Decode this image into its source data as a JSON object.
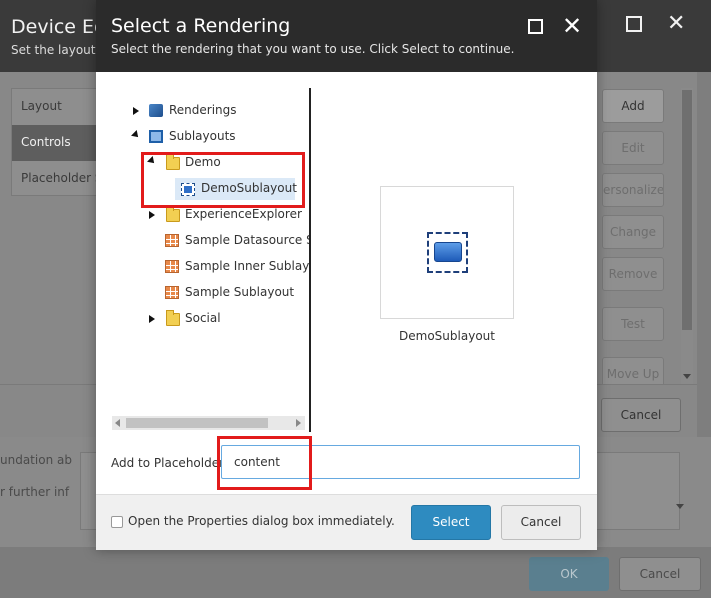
{
  "background_dialog": {
    "title": "Device Edi",
    "subtitle": "Set the layouts,",
    "tabs": [
      "Layout",
      "Controls",
      "Placeholder S"
    ],
    "buttons": [
      "Add",
      "Edit",
      "ersonalize",
      "Change",
      "Remove",
      "Test",
      "Move Up"
    ],
    "cancel_label": "Cancel",
    "body_lines": [
      "undation ab",
      "r further inf"
    ],
    "ok_label": "OK",
    "cancel2_label": "Cancel"
  },
  "modal": {
    "title": "Select a Rendering",
    "subtitle": "Select the rendering that you want to use. Click Select to continue.",
    "tree": [
      {
        "label": "Renderings",
        "icon": "renderings-icon"
      },
      {
        "label": "Sublayouts",
        "icon": "sublayouts-icon"
      },
      {
        "label": "Demo",
        "icon": "folder-icon"
      },
      {
        "label": "DemoSublayout",
        "icon": "sublayout-item-icon"
      },
      {
        "label": "ExperienceExplorer",
        "icon": "folder-icon"
      },
      {
        "label": "Sample Datasource Su",
        "icon": "grid-icon"
      },
      {
        "label": "Sample Inner Sublayou",
        "icon": "grid-icon"
      },
      {
        "label": "Sample Sublayout",
        "icon": "grid-icon"
      },
      {
        "label": "Social",
        "icon": "folder-icon"
      }
    ],
    "preview_label": "DemoSublayout",
    "placeholder_label": "Add to Placeholder",
    "placeholder_value": "content",
    "checkbox_label": "Open the Properties dialog box immediately.",
    "select_label": "Select",
    "cancel_label": "Cancel"
  },
  "colors": {
    "header": "#2b2b2b",
    "select_button": "#2e8bc0",
    "highlight": "#e21b1b",
    "selection": "#dbe9f7"
  }
}
